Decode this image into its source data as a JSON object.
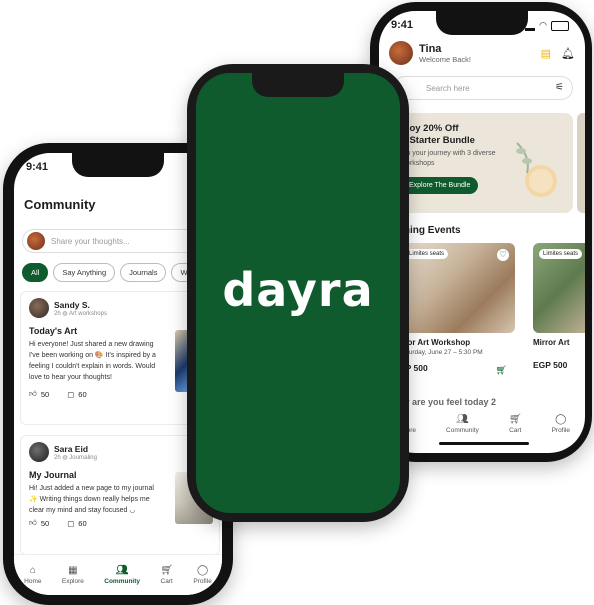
{
  "brand": {
    "logo_text": "dayra",
    "primary_color": "#0f5b2e"
  },
  "left_phone": {
    "time": "9:41",
    "title": "Community",
    "composer_placeholder": "Share your thoughts...",
    "chips": [
      "All",
      "Say Anything",
      "Journals",
      "W"
    ],
    "posts": [
      {
        "author": "Sandy S.",
        "time": "2h",
        "category": "Art workshops",
        "title": "Today's Art",
        "body": "Hi everyone! Just shared a new drawing I've been working on 🎨 It's inspired by a feeling I couldn't explain in words. Would love to hear your thoughts!",
        "likes": "50",
        "comments": "60"
      },
      {
        "author": "Sara Eid",
        "time": "2h",
        "category": "Journaling",
        "title": "My Journal",
        "body": "Hi! Just added a new page to my journal ✨ Writing things down really helps me clear my mind and stay focused ◡",
        "likes": "50",
        "comments": "60"
      }
    ],
    "nav": [
      "Home",
      "Explore",
      "Community",
      "Cart",
      "Profile"
    ]
  },
  "right_phone": {
    "time": "9:41",
    "user_name": "Tina",
    "welcome": "Welcome Back!",
    "search_placeholder": "Search here",
    "promo": {
      "line1": "njoy 20% Off",
      "line2": "n Starter Bundle",
      "sub": "gin your journey with 3 diverse workshops",
      "button": "Explore The Bundle"
    },
    "section_title": "oming Events",
    "events": [
      {
        "badge": "Limites seats",
        "title": "irror Art Workshop",
        "date": "Saturday, June 27 – 5:30 PM",
        "price": "GP 500"
      },
      {
        "badge": "Limites seats",
        "title": "Mirror Art",
        "date": "",
        "price": "EGP 500"
      }
    ],
    "feel_text": "ow are you feel today 2",
    "nav": [
      "Explore",
      "Community",
      "Cart",
      "Profile"
    ]
  }
}
